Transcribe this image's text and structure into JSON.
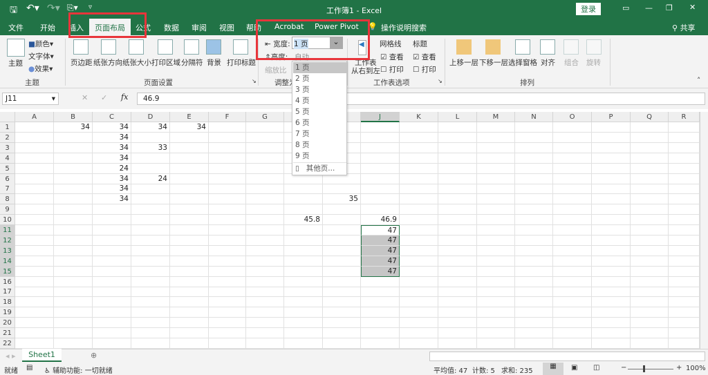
{
  "title_bar": {
    "doc_title": "工作簿1  -  Excel",
    "login": "登录",
    "qat_icons": [
      "save-icon",
      "undo-icon",
      "redo-icon",
      "touch-mode-icon",
      "customize-icon"
    ]
  },
  "tabs": [
    {
      "label": "文件"
    },
    {
      "label": "开始"
    },
    {
      "label": "插入"
    },
    {
      "label": "页面布局",
      "active": true
    },
    {
      "label": "公式"
    },
    {
      "label": "数据"
    },
    {
      "label": "审阅"
    },
    {
      "label": "视图"
    },
    {
      "label": "帮助"
    },
    {
      "label": "Acrobat"
    },
    {
      "label": "Power Pivot"
    }
  ],
  "tell_me": "操作说明搜索",
  "share": "共享",
  "ribbon": {
    "theme": {
      "themes": "主题",
      "colors": "颜色",
      "fonts": "字体",
      "effects": "效果",
      "group": "主题"
    },
    "page_setup": {
      "items": [
        "页边距",
        "纸张方向",
        "纸张大小",
        "打印区域",
        "分隔符",
        "背景",
        "打印标题"
      ],
      "group": "页面设置"
    },
    "scale": {
      "width_label": "宽度:",
      "width_value": "1 页",
      "height_label": "高度:",
      "height_value": "自动",
      "scale_label": "缩放比",
      "group": "调整为"
    },
    "sheet_options": {
      "rtl": [
        "工作表",
        "从右到左"
      ],
      "gridlines": "网格线",
      "headings": "标题",
      "view": "查看",
      "print": "打印",
      "gridlines_view": true,
      "gridlines_print": false,
      "headings_view": true,
      "headings_print": false,
      "group": "工作表选项"
    },
    "arrange": {
      "items": [
        "上移一层",
        "下移一层",
        "选择窗格",
        "对齐",
        "组合",
        "旋转"
      ],
      "group": "排列"
    }
  },
  "dropdown": {
    "options": [
      "1 页",
      "2 页",
      "3 页",
      "4 页",
      "5 页",
      "6 页",
      "7 页",
      "8 页",
      "9 页"
    ],
    "selected": "1 页",
    "more": "其他页..."
  },
  "formula_bar": {
    "name_box": "J11",
    "formula": "46.9",
    "fx": "fx"
  },
  "grid": {
    "columns": [
      "A",
      "B",
      "C",
      "D",
      "E",
      "F",
      "G",
      "H",
      "I",
      "J",
      "K",
      "L",
      "M",
      "N",
      "O",
      "P",
      "Q",
      "R"
    ],
    "rows": 22,
    "cells": {
      "B1": "34",
      "C1": "34",
      "D1": "34",
      "E1": "34",
      "C2": "34",
      "C3": "34",
      "D3": "33",
      "C4": "34",
      "C5": "24",
      "C6": "34",
      "D6": "24",
      "C7": "34",
      "C8": "34",
      "I8": "35",
      "H10": "45.8",
      "J10": "46.9",
      "J11": "47",
      "J12": "47",
      "J13": "47",
      "J14": "47",
      "J15": "47"
    },
    "selection": "J11:J15",
    "active_column": "J"
  },
  "sheet_tabs": [
    {
      "label": "Sheet1",
      "active": true
    }
  ],
  "status": {
    "ready": "就绪",
    "accessibility": "辅助功能: 一切就绪",
    "average": "平均值: 47",
    "count": "计数: 5",
    "sum": "求和: 235",
    "zoom": "100%"
  },
  "colors": {
    "brand": "#217346",
    "highlight": "#e8353b",
    "selection": "#c6c6c6"
  }
}
